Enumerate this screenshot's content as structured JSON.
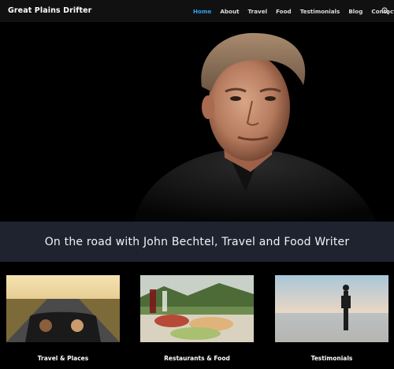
{
  "site": {
    "logo": "Great Plains Drifter"
  },
  "nav": {
    "items": [
      "Home",
      "About",
      "Travel",
      "Food",
      "Testimonials",
      "Blog",
      "Contact"
    ],
    "active": "Home",
    "search_icon": "search-icon"
  },
  "hero": {
    "image": "portrait of a man in black shirt"
  },
  "band": {
    "text": "On the road with John Bechtel, Travel and Food Writer"
  },
  "cards": [
    {
      "title": "Travel & Places"
    },
    {
      "title": "Restaurants & Food"
    },
    {
      "title": "Testimonials"
    }
  ],
  "colors": {
    "header_bg": "#111111",
    "accent": "#2ea3f2",
    "band_bg": "#1f2330",
    "page_bg": "#000000"
  }
}
